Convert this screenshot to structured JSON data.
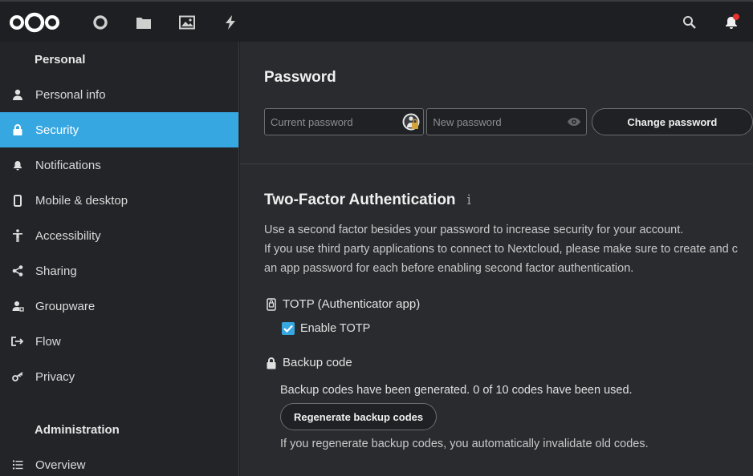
{
  "topbar": {
    "apps": [
      {
        "name": "dashboard-icon"
      },
      {
        "name": "files-icon"
      },
      {
        "name": "photos-icon"
      },
      {
        "name": "activity-icon"
      }
    ],
    "notification_dot_color": "#e9322d"
  },
  "sidebar": {
    "personal_heading": "Personal",
    "admin_heading": "Administration",
    "items": [
      {
        "label": "Personal info",
        "icon": "user-icon"
      },
      {
        "label": "Security",
        "icon": "lock-icon",
        "active": true
      },
      {
        "label": "Notifications",
        "icon": "bell-icon"
      },
      {
        "label": "Mobile & desktop",
        "icon": "phone-icon"
      },
      {
        "label": "Accessibility",
        "icon": "accessibility-icon"
      },
      {
        "label": "Sharing",
        "icon": "share-icon"
      },
      {
        "label": "Groupware",
        "icon": "groupware-icon"
      },
      {
        "label": "Flow",
        "icon": "flow-icon"
      },
      {
        "label": "Privacy",
        "icon": "key-icon"
      }
    ],
    "admin_items": [
      {
        "label": "Overview",
        "icon": "list-icon"
      }
    ]
  },
  "password": {
    "title": "Password",
    "current_placeholder": "Current password",
    "new_placeholder": "New password",
    "change_label": "Change password"
  },
  "tfa": {
    "title": "Two-Factor Authentication",
    "info": "i",
    "desc_line1": "Use a second factor besides your password to increase security for your account.",
    "desc_line2": "If you use third party applications to connect to Nextcloud, please make sure to create and c",
    "desc_line3": "an app password for each before enabling second factor authentication.",
    "totp_title": "TOTP (Authenticator app)",
    "totp_enable_label": "Enable TOTP",
    "totp_enabled": true,
    "backup_title": "Backup code",
    "backup_status": "Backup codes have been generated. 0 of 10 codes have been used.",
    "regen_label": "Regenerate backup codes",
    "backup_note": "If you regenerate backup codes, you automatically invalidate old codes."
  },
  "colors": {
    "accent": "#37a7e1",
    "background": "#292b2f",
    "sidebar": "#222428",
    "header": "#1d1f22"
  }
}
